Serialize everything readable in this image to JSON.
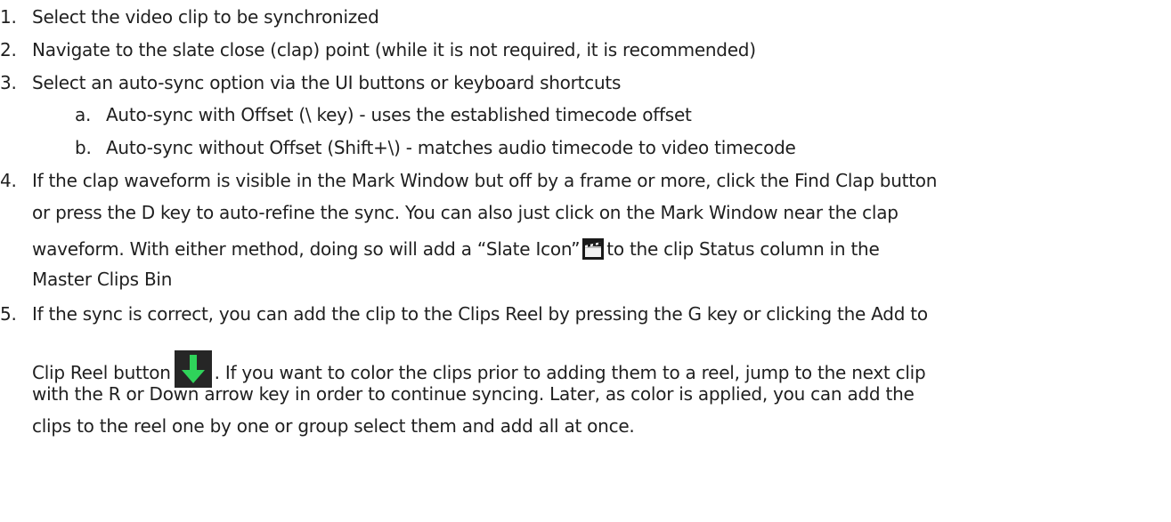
{
  "steps": [
    {
      "number": "1.",
      "lines": [
        "Select the video clip to be synchronized"
      ]
    },
    {
      "number": "2.",
      "lines": [
        "Navigate to the slate close (clap) point (while it is not required, it is recommended)"
      ]
    },
    {
      "number": "3.",
      "lines": [
        "Select an auto-sync option via the UI buttons or keyboard shortcuts"
      ],
      "substeps": [
        {
          "letter": "a.",
          "text": "Auto-sync with Offset (\\ key) - uses the established timecode offset"
        },
        {
          "letter": "b.",
          "text": "Auto-sync without Offset (Shift+\\) - matches audio timecode to video timecode"
        }
      ]
    },
    {
      "number": "4.",
      "lines": [
        "If the clap waveform is visible in the Mark Window but off by a frame or more, click the Find Clap button",
        "or press the D key to auto-refine the sync.  You can also just click on the Mark Window near the clap"
      ],
      "line3_before_icon": "waveform.  With either method, doing so will add a “Slate Icon”",
      "line3_after_icon": "to the clip Status column in the",
      "line4": "Master Clips Bin"
    },
    {
      "number": "5.",
      "line1": "If the sync is correct, you can add the clip to the Clips Reel by pressing the G key or clicking the Add to",
      "line2_before_icon": "Clip Reel button",
      "line2_after_icon": ".  If you want to color the clips prior to adding them to a reel, jump to the next clip",
      "line3": "with the R or Down arrow key in order to continue syncing.  Later, as color is applied, you can add the",
      "line4": "clips to the reel one by one or group select them and add all at once."
    }
  ],
  "icons": {
    "slate": "slate-icon",
    "add_to_clip_reel": "down-arrow-icon",
    "add_to_clip_reel_color": "#2fd35a"
  }
}
